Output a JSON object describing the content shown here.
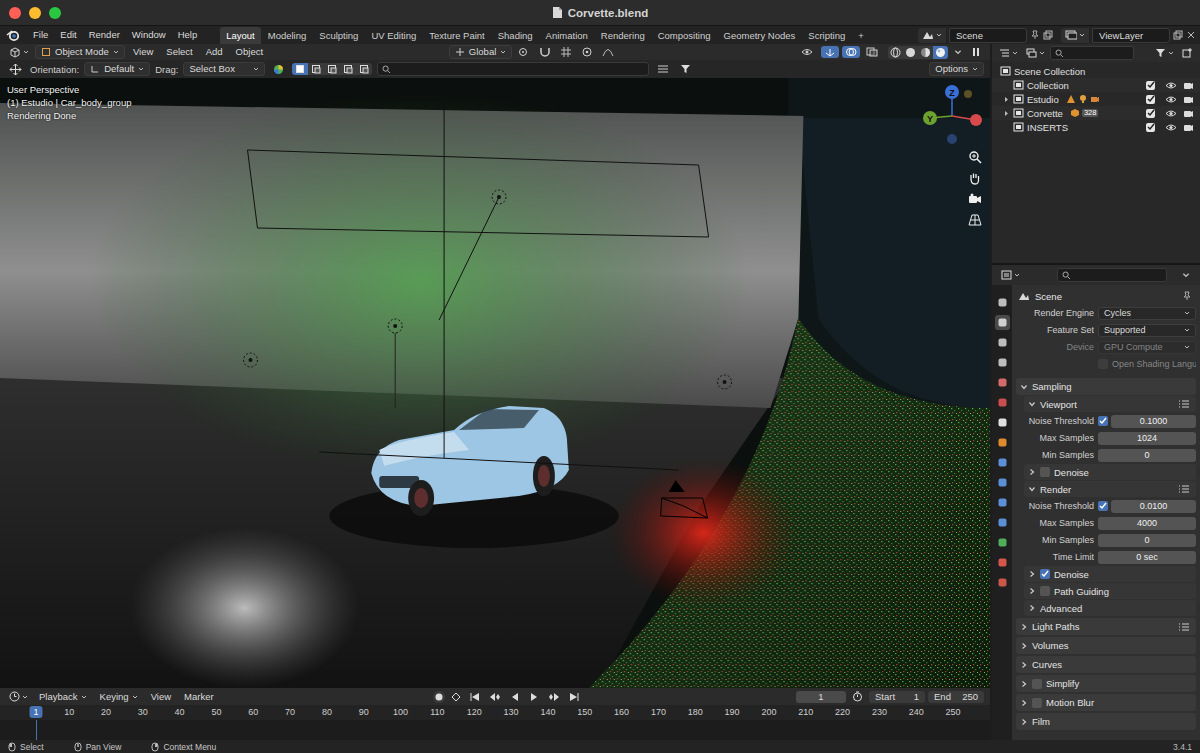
{
  "window": {
    "title": "Corvette.blend"
  },
  "menu": [
    "File",
    "Edit",
    "Render",
    "Window",
    "Help"
  ],
  "workspaces": [
    {
      "label": "Layout",
      "selected": true
    },
    {
      "label": "Modeling",
      "selected": false
    },
    {
      "label": "Sculpting",
      "selected": false
    },
    {
      "label": "UV Editing",
      "selected": false
    },
    {
      "label": "Texture Paint",
      "selected": false
    },
    {
      "label": "Shading",
      "selected": false
    },
    {
      "label": "Animation",
      "selected": false
    },
    {
      "label": "Rendering",
      "selected": false
    },
    {
      "label": "Compositing",
      "selected": false
    },
    {
      "label": "Geometry Nodes",
      "selected": false
    },
    {
      "label": "Scripting",
      "selected": false
    }
  ],
  "add_workspace": "+",
  "scene": {
    "label": "Scene"
  },
  "view_layer": {
    "label": "ViewLayer"
  },
  "viewport": {
    "mode": "Object Mode",
    "menus": [
      "View",
      "Select",
      "Add",
      "Object"
    ],
    "transform_orientation": "Global",
    "shading_modes": [
      {
        "kind": "wireframe",
        "selected": false
      },
      {
        "kind": "solid",
        "selected": false
      },
      {
        "kind": "material",
        "selected": false
      },
      {
        "kind": "rendered",
        "selected": true
      }
    ],
    "tool_settings": {
      "orientation_label": "Orientation:",
      "orientation": "Default",
      "drag_label": "Drag:",
      "drag": "Select Box",
      "options": "Options"
    },
    "select_modes": [
      {
        "kind": "set",
        "selected": true
      },
      {
        "kind": "extend",
        "selected": false
      },
      {
        "kind": "subtract",
        "selected": false
      },
      {
        "kind": "invert",
        "selected": false
      },
      {
        "kind": "intersect",
        "selected": false
      }
    ],
    "overlay_text": [
      "User Perspective",
      "(1) Estudio | Car_body_group",
      "Rendering Done"
    ],
    "gizmo_axes": [
      {
        "label": "Z",
        "color": "#3b6fd8"
      },
      {
        "label": "Y",
        "color": "#6ea22e"
      }
    ]
  },
  "timeline": {
    "menus": [
      {
        "label": "Playback",
        "dropdown": true
      },
      {
        "label": "Keying",
        "dropdown": true
      },
      {
        "label": "View",
        "dropdown": false
      },
      {
        "label": "Marker",
        "dropdown": false
      }
    ],
    "current_frame": "1",
    "start_label": "Start",
    "start": "1",
    "end_label": "End",
    "end": "250",
    "ticks": [
      "1",
      "10",
      "20",
      "30",
      "40",
      "50",
      "60",
      "70",
      "80",
      "90",
      "100",
      "110",
      "120",
      "130",
      "140",
      "150",
      "160",
      "170",
      "180",
      "190",
      "200",
      "210",
      "220",
      "230",
      "240",
      "250"
    ]
  },
  "outliner": {
    "root": "Scene Collection",
    "collections": [
      {
        "label": "Collection",
        "kind": "plain",
        "expandable": false,
        "expanded": false,
        "included": true,
        "visible": true,
        "renderable": true
      },
      {
        "label": "Estudio",
        "kind": "studio",
        "expandable": true,
        "expanded": false,
        "included": true,
        "visible": true,
        "renderable": true
      },
      {
        "label": "Corvette",
        "kind": "group",
        "expandable": true,
        "expanded": false,
        "included": true,
        "visible": true,
        "renderable": true,
        "badge": "328"
      },
      {
        "label": "INSERTS",
        "kind": "plain",
        "expandable": false,
        "expanded": false,
        "included": true,
        "visible": true,
        "renderable": true
      }
    ]
  },
  "properties": {
    "context": "Scene",
    "tabs": [
      {
        "kind": "tool",
        "selected": false
      },
      {
        "kind": "render",
        "selected": true
      },
      {
        "kind": "output",
        "selected": false
      },
      {
        "kind": "view_layer",
        "selected": false
      },
      {
        "kind": "scene",
        "selected": false
      },
      {
        "kind": "world",
        "selected": false
      },
      {
        "kind": "collection",
        "selected": false
      },
      {
        "kind": "object",
        "selected": false
      },
      {
        "kind": "modifier",
        "selected": false
      },
      {
        "kind": "particles",
        "selected": false
      },
      {
        "kind": "physics",
        "selected": false
      },
      {
        "kind": "constraints",
        "selected": false
      },
      {
        "kind": "data",
        "selected": false
      },
      {
        "kind": "material",
        "selected": false
      },
      {
        "kind": "texture",
        "selected": false
      }
    ],
    "rows": [
      {
        "kind": "dropdown",
        "label": "Render Engine",
        "value": "Cycles",
        "disabled": false
      },
      {
        "kind": "dropdown",
        "label": "Feature Set",
        "value": "Supported",
        "disabled": false
      },
      {
        "kind": "dropdown",
        "label": "Device",
        "value": "GPU Compute",
        "disabled": true
      },
      {
        "kind": "checkbox",
        "label": "Open Shading Langu",
        "checked": false,
        "disabled": true
      },
      {
        "kind": "panel",
        "label": "Sampling",
        "expanded": true,
        "toggle": false,
        "checked": false,
        "presets": false
      },
      {
        "kind": "subpanel",
        "label": "Viewport",
        "expanded": true,
        "toggle": false,
        "checked": false,
        "presets": true
      },
      {
        "kind": "number",
        "label": "Noise Threshold",
        "value": "0.1000",
        "toggle": true,
        "checked": true
      },
      {
        "kind": "number",
        "label": "Max Samples",
        "value": "1024",
        "toggle": false,
        "checked": false
      },
      {
        "kind": "number",
        "label": "Min Samples",
        "value": "0",
        "toggle": false,
        "checked": false
      },
      {
        "kind": "subpanel",
        "label": "Denoise",
        "expanded": false,
        "toggle": true,
        "checked": false,
        "presets": false
      },
      {
        "kind": "subpanel",
        "label": "Render",
        "expanded": true,
        "toggle": false,
        "checked": false,
        "presets": true
      },
      {
        "kind": "number",
        "label": "Noise Threshold",
        "value": "0.0100",
        "toggle": true,
        "checked": true
      },
      {
        "kind": "number",
        "label": "Max Samples",
        "value": "4000",
        "toggle": false,
        "checked": false
      },
      {
        "kind": "number",
        "label": "Min Samples",
        "value": "0",
        "toggle": false,
        "checked": false
      },
      {
        "kind": "number",
        "label": "Time Limit",
        "value": "0 sec",
        "toggle": false,
        "checked": false
      },
      {
        "kind": "subpanel",
        "label": "Denoise",
        "expanded": false,
        "toggle": true,
        "checked": true,
        "presets": false
      },
      {
        "kind": "subpanel",
        "label": "Path Guiding",
        "expanded": false,
        "toggle": true,
        "checked": false,
        "presets": false
      },
      {
        "kind": "subpanel",
        "label": "Advanced",
        "expanded": false,
        "toggle": false,
        "checked": false,
        "presets": false
      },
      {
        "kind": "panel",
        "label": "Light Paths",
        "expanded": false,
        "toggle": false,
        "checked": false,
        "presets": true
      },
      {
        "kind": "panel",
        "label": "Volumes",
        "expanded": false,
        "toggle": false,
        "checked": false,
        "presets": false
      },
      {
        "kind": "panel",
        "label": "Curves",
        "expanded": false,
        "toggle": false,
        "checked": false,
        "presets": false
      },
      {
        "kind": "panel",
        "label": "Simplify",
        "expanded": false,
        "toggle": true,
        "checked": false,
        "presets": false
      },
      {
        "kind": "panel",
        "label": "Motion Blur",
        "expanded": false,
        "toggle": true,
        "checked": false,
        "presets": false
      },
      {
        "kind": "panel",
        "label": "Film",
        "expanded": false,
        "toggle": false,
        "checked": false,
        "presets": false
      }
    ]
  },
  "status_bar": {
    "hints": [
      "Select",
      "Pan View",
      "Context Menu"
    ],
    "version": "3.4.1"
  }
}
